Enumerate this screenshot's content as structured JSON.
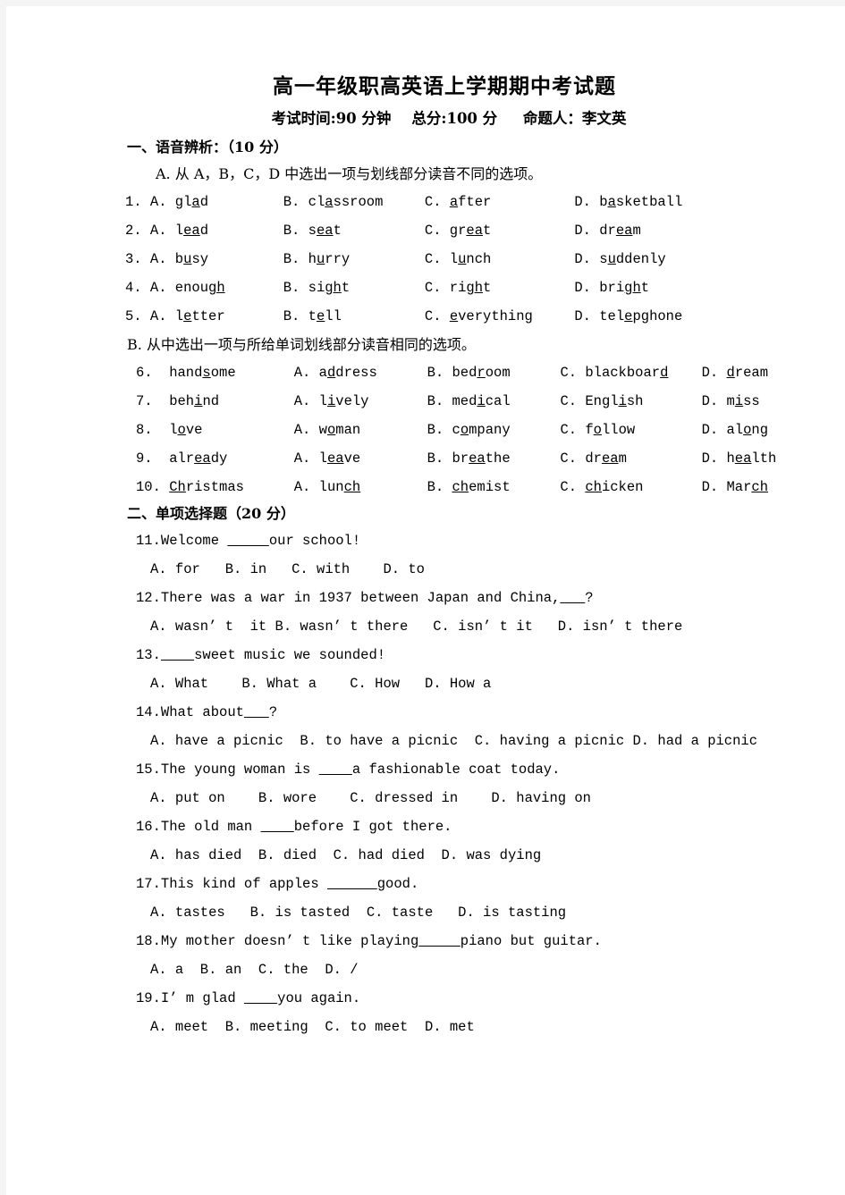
{
  "document": {
    "title": "高一年级职高英语上学期期中考试题",
    "subtitle": "考试时间:90 分钟    总分:100 分     命题人：李文英"
  },
  "section_one": {
    "heading": "一、语音辨析：（10 分）",
    "part_a_instruction": "A. 从 A，B，C，D 中选出一项与划线部分读音不同的选项。",
    "part_a_items": [
      {
        "num": "1.",
        "options": [
          {
            "label": "A.",
            "pre": "gl",
            "mark": "a",
            "post": "d"
          },
          {
            "label": "B.",
            "pre": "cl",
            "mark": "a",
            "post": "ssroom"
          },
          {
            "label": "C.",
            "pre": "",
            "mark": "a",
            "post": "fter"
          },
          {
            "label": "D.",
            "pre": "b",
            "mark": "a",
            "post": "sketball"
          }
        ]
      },
      {
        "num": "2.",
        "options": [
          {
            "label": "A.",
            "pre": "l",
            "mark": "ea",
            "post": "d"
          },
          {
            "label": "B.",
            "pre": "s",
            "mark": "ea",
            "post": "t"
          },
          {
            "label": "C.",
            "pre": "gr",
            "mark": "ea",
            "post": "t"
          },
          {
            "label": "D.",
            "pre": "dr",
            "mark": "ea",
            "post": "m"
          }
        ]
      },
      {
        "num": "3.",
        "options": [
          {
            "label": "A.",
            "pre": "b",
            "mark": "u",
            "post": "sy"
          },
          {
            "label": "B.",
            "pre": "h",
            "mark": "u",
            "post": "rry"
          },
          {
            "label": "C.",
            "pre": "l",
            "mark": "u",
            "post": "nch"
          },
          {
            "label": "D.",
            "pre": "s",
            "mark": "u",
            "post": "ddenly"
          }
        ]
      },
      {
        "num": "4.",
        "options": [
          {
            "label": "A.",
            "pre": "enou",
            "mark": "gh",
            "post": ""
          },
          {
            "label": "B.",
            "pre": "si",
            "mark": "gh",
            "post": "t"
          },
          {
            "label": "C.",
            "pre": "ri",
            "mark": "gh",
            "post": "t"
          },
          {
            "label": "D.",
            "pre": "bri",
            "mark": "gh",
            "post": "t"
          }
        ]
      },
      {
        "num": "5.",
        "options": [
          {
            "label": "A.",
            "pre": "l",
            "mark": "e",
            "post": "tter"
          },
          {
            "label": "B.",
            "pre": "t",
            "mark": "e",
            "post": "ll"
          },
          {
            "label": "C.",
            "pre": "",
            "mark": "e",
            "post": "verything"
          },
          {
            "label": "D.",
            "pre": "tel",
            "mark": "e",
            "post": "pghone"
          }
        ]
      }
    ],
    "part_b_instruction": "B. 从中选出一项与所给单词划线部分读音相同的选项。",
    "part_b_items": [
      {
        "num": "6.",
        "stem": {
          "pre": "hand",
          "mark": "s",
          "post": "ome"
        },
        "options": [
          {
            "label": "A.",
            "pre": "a",
            "mark": "d",
            "post": "dress"
          },
          {
            "label": "B.",
            "pre": "bed",
            "mark": "r",
            "post": "oom"
          },
          {
            "label": "C.",
            "pre": "blackboar",
            "mark": "d",
            "post": ""
          },
          {
            "label": "D.",
            "pre": "",
            "mark": "d",
            "post": "ream"
          }
        ]
      },
      {
        "num": "7.",
        "stem": {
          "pre": "beh",
          "mark": "i",
          "post": "nd"
        },
        "options": [
          {
            "label": "A.",
            "pre": "l",
            "mark": "i",
            "post": "vely"
          },
          {
            "label": "B.",
            "pre": "med",
            "mark": "i",
            "post": "cal"
          },
          {
            "label": "C.",
            "pre": "Engl",
            "mark": "i",
            "post": "sh"
          },
          {
            "label": "D.",
            "pre": "m",
            "mark": "i",
            "post": "ss"
          }
        ]
      },
      {
        "num": "8.",
        "stem": {
          "pre": "l",
          "mark": "o",
          "post": "ve"
        },
        "options": [
          {
            "label": "A.",
            "pre": "w",
            "mark": "o",
            "post": "man"
          },
          {
            "label": "B.",
            "pre": "c",
            "mark": "o",
            "post": "mpany"
          },
          {
            "label": "C.",
            "pre": "f",
            "mark": "o",
            "post": "llow"
          },
          {
            "label": "D.",
            "pre": "al",
            "mark": "o",
            "post": "ng"
          }
        ]
      },
      {
        "num": "9.",
        "stem": {
          "pre": "alr",
          "mark": "ea",
          "post": "dy"
        },
        "options": [
          {
            "label": "A.",
            "pre": "l",
            "mark": "ea",
            "post": "ve"
          },
          {
            "label": "B.",
            "pre": "br",
            "mark": "ea",
            "post": "the"
          },
          {
            "label": "C.",
            "pre": "dr",
            "mark": "ea",
            "post": "m"
          },
          {
            "label": "D.",
            "pre": "h",
            "mark": "ea",
            "post": "lth"
          }
        ]
      },
      {
        "num": "10.",
        "stem": {
          "pre": "",
          "mark": "Ch",
          "post": "ristmas"
        },
        "options": [
          {
            "label": "A.",
            "pre": "lun",
            "mark": "ch",
            "post": ""
          },
          {
            "label": "B.",
            "pre": "",
            "mark": "ch",
            "post": "emist"
          },
          {
            "label": "C.",
            "pre": "",
            "mark": "ch",
            "post": "icken"
          },
          {
            "label": "D.",
            "pre": "Mar",
            "mark": "ch",
            "post": ""
          }
        ]
      }
    ]
  },
  "section_two": {
    "heading": "二、单项选择题（20 分）",
    "questions": [
      {
        "num": "11.",
        "stem_pre": "Welcome ",
        "blank": "_____",
        "stem_post": "our school!",
        "options": "A. for   B. in   C. with    D. to"
      },
      {
        "num": "12.",
        "stem_pre": "There was a war in 1937 between Japan and China,",
        "blank": "___",
        "stem_post": "?",
        "options": "A. wasn’ t  it B. wasn’ t there   C. isn’ t it   D. isn’ t there"
      },
      {
        "num": "13.",
        "stem_pre": "",
        "blank": "____",
        "stem_post": "sweet music we sounded!",
        "options": "A. What    B. What a    C. How   D. How a"
      },
      {
        "num": "14.",
        "stem_pre": "What about",
        "blank": "___",
        "stem_post": "?",
        "options": "A. have a picnic  B. to have a picnic  C. having a picnic D. had a picnic"
      },
      {
        "num": "15.",
        "stem_pre": "The young woman is ",
        "blank": "____",
        "stem_post": "a fashionable coat today.",
        "options": "A. put on    B. wore    C. dressed in    D. having on"
      },
      {
        "num": "16.",
        "stem_pre": "The old man ",
        "blank": "____",
        "stem_post": "before I got there.",
        "options": "A. has died  B. died  C. had died  D. was dying"
      },
      {
        "num": "17.",
        "stem_pre": "This kind of apples ",
        "blank": "______",
        "stem_post": "good.",
        "options": "A. tastes   B. is tasted  C. taste   D. is tasting"
      },
      {
        "num": "18.",
        "stem_pre": "My mother doesn’ t like playing",
        "blank": "_____",
        "stem_post": "piano but guitar.",
        "options": "A. a  B. an  C. the  D. /"
      },
      {
        "num": "19.",
        "stem_pre": "I’ m glad ",
        "blank": "____",
        "stem_post": "you again.",
        "options": "A. meet  B. meeting  C. to meet  D. met"
      }
    ]
  }
}
